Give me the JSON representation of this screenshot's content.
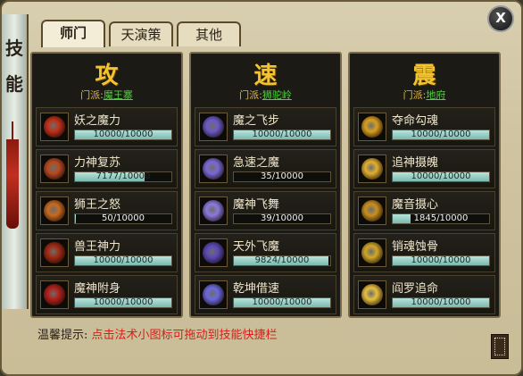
{
  "window": {
    "close_label": "X"
  },
  "scroll": {
    "glyphs": [
      "技",
      "能"
    ]
  },
  "tabs": [
    {
      "label": "师门",
      "active": true
    },
    {
      "label": "天演策",
      "active": false
    },
    {
      "label": "其他",
      "active": false
    }
  ],
  "columns": [
    {
      "title": "攻",
      "sect_label": "门派:",
      "sect_name": "魔王寨",
      "skills": [
        {
          "name": "妖之魔力",
          "value": "10000/10000",
          "fraction": 1.0,
          "icon": "demon-power-icon",
          "icon_color": "#c0301a"
        },
        {
          "name": "力神复苏",
          "value": "7177/10000",
          "fraction": 0.7177,
          "icon": "strength-revive-icon",
          "icon_color": "#b84a20"
        },
        {
          "name": "狮王之怒",
          "value": "50/10000",
          "fraction": 0.005,
          "icon": "lion-king-rage-icon",
          "icon_color": "#c86a20"
        },
        {
          "name": "兽王神力",
          "value": "10000/10000",
          "fraction": 1.0,
          "icon": "beast-king-power-icon",
          "icon_color": "#a02a14"
        },
        {
          "name": "魔神附身",
          "value": "10000/10000",
          "fraction": 1.0,
          "icon": "demon-god-possession-icon",
          "icon_color": "#b0201a"
        }
      ]
    },
    {
      "title": "速",
      "sect_label": "门派:",
      "sect_name": "狮驼岭",
      "skills": [
        {
          "name": "魔之飞步",
          "value": "10000/10000",
          "fraction": 1.0,
          "icon": "demon-flying-step-icon",
          "icon_color": "#6a5ac8"
        },
        {
          "name": "急速之魔",
          "value": "35/10000",
          "fraction": 0.0035,
          "icon": "swift-demon-icon",
          "icon_color": "#7a6ad8"
        },
        {
          "name": "魔神飞舞",
          "value": "39/10000",
          "fraction": 0.0039,
          "icon": "demon-god-dance-icon",
          "icon_color": "#8a7ae0"
        },
        {
          "name": "天外飞魔",
          "value": "9824/10000",
          "fraction": 0.9824,
          "icon": "sky-flying-demon-icon",
          "icon_color": "#5a4ab8"
        },
        {
          "name": "乾坤借速",
          "value": "10000/10000",
          "fraction": 1.0,
          "icon": "cosmos-borrow-speed-icon",
          "icon_color": "#6a6ae0"
        }
      ]
    },
    {
      "title": "震",
      "sect_label": "门派:",
      "sect_name": "地府",
      "skills": [
        {
          "name": "夺命勾魂",
          "value": "10000/10000",
          "fraction": 1.0,
          "icon": "soul-hook-icon",
          "icon_color": "#d8a020"
        },
        {
          "name": "追神摄魄",
          "value": "10000/10000",
          "fraction": 1.0,
          "icon": "spirit-chase-icon",
          "icon_color": "#e0b030"
        },
        {
          "name": "魔音摄心",
          "value": "1845/10000",
          "fraction": 0.1845,
          "icon": "demon-sound-icon",
          "icon_color": "#c89020"
        },
        {
          "name": "销魂蚀骨",
          "value": "10000/10000",
          "fraction": 1.0,
          "icon": "soul-erode-icon",
          "icon_color": "#d0a828"
        },
        {
          "name": "阎罗追命",
          "value": "10000/10000",
          "fraction": 1.0,
          "icon": "yama-chase-icon",
          "icon_color": "#e8c040"
        }
      ]
    }
  ],
  "footer": {
    "tip_label": "温馨提示:",
    "tip_text": "点击法术小图标可拖动到技能快捷栏"
  }
}
